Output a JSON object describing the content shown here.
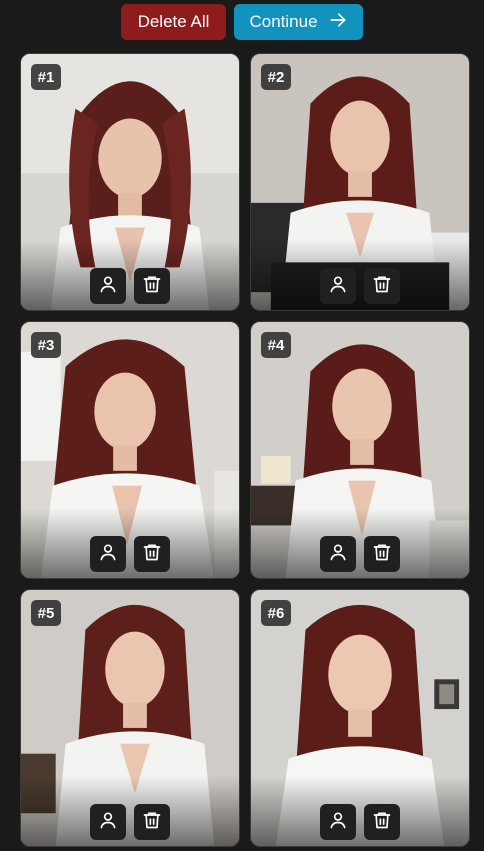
{
  "toolbar": {
    "delete_all_label": "Delete All",
    "continue_label": "Continue",
    "delete_color": "#8e1c1c",
    "continue_color": "#1193bd"
  },
  "cards": [
    {
      "badge": "#1",
      "icons": [
        "person-icon",
        "trash-icon"
      ]
    },
    {
      "badge": "#2",
      "icons": [
        "person-icon",
        "trash-icon"
      ]
    },
    {
      "badge": "#3",
      "icons": [
        "person-icon",
        "trash-icon"
      ]
    },
    {
      "badge": "#4",
      "icons": [
        "person-icon",
        "trash-icon"
      ]
    },
    {
      "badge": "#5",
      "icons": [
        "person-icon",
        "trash-icon"
      ]
    },
    {
      "badge": "#6",
      "icons": [
        "person-icon",
        "trash-icon"
      ]
    }
  ]
}
